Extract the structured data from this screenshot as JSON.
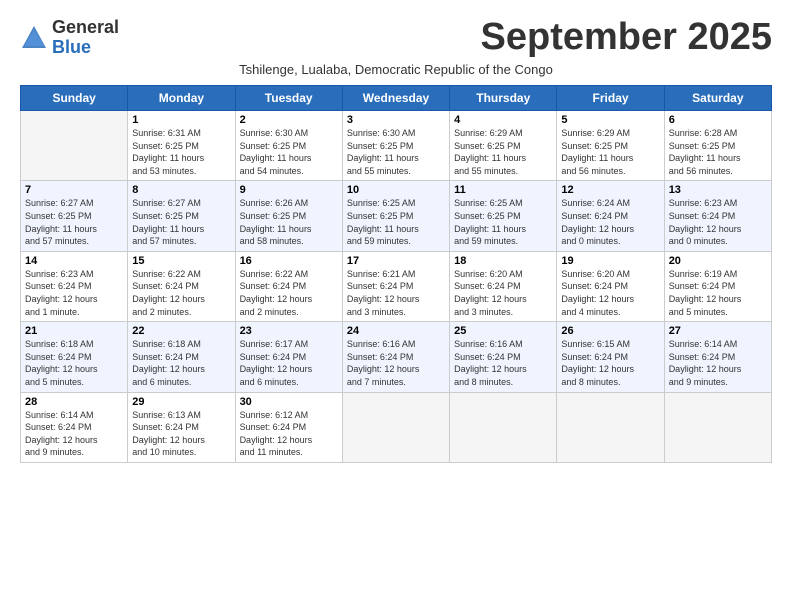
{
  "logo": {
    "general": "General",
    "blue": "Blue"
  },
  "title": "September 2025",
  "subtitle": "Tshilenge, Lualaba, Democratic Republic of the Congo",
  "days_of_week": [
    "Sunday",
    "Monday",
    "Tuesday",
    "Wednesday",
    "Thursday",
    "Friday",
    "Saturday"
  ],
  "weeks": [
    [
      {
        "day": "",
        "info": ""
      },
      {
        "day": "1",
        "info": "Sunrise: 6:31 AM\nSunset: 6:25 PM\nDaylight: 11 hours\nand 53 minutes."
      },
      {
        "day": "2",
        "info": "Sunrise: 6:30 AM\nSunset: 6:25 PM\nDaylight: 11 hours\nand 54 minutes."
      },
      {
        "day": "3",
        "info": "Sunrise: 6:30 AM\nSunset: 6:25 PM\nDaylight: 11 hours\nand 55 minutes."
      },
      {
        "day": "4",
        "info": "Sunrise: 6:29 AM\nSunset: 6:25 PM\nDaylight: 11 hours\nand 55 minutes."
      },
      {
        "day": "5",
        "info": "Sunrise: 6:29 AM\nSunset: 6:25 PM\nDaylight: 11 hours\nand 56 minutes."
      },
      {
        "day": "6",
        "info": "Sunrise: 6:28 AM\nSunset: 6:25 PM\nDaylight: 11 hours\nand 56 minutes."
      }
    ],
    [
      {
        "day": "7",
        "info": "Sunrise: 6:27 AM\nSunset: 6:25 PM\nDaylight: 11 hours\nand 57 minutes."
      },
      {
        "day": "8",
        "info": "Sunrise: 6:27 AM\nSunset: 6:25 PM\nDaylight: 11 hours\nand 57 minutes."
      },
      {
        "day": "9",
        "info": "Sunrise: 6:26 AM\nSunset: 6:25 PM\nDaylight: 11 hours\nand 58 minutes."
      },
      {
        "day": "10",
        "info": "Sunrise: 6:25 AM\nSunset: 6:25 PM\nDaylight: 11 hours\nand 59 minutes."
      },
      {
        "day": "11",
        "info": "Sunrise: 6:25 AM\nSunset: 6:25 PM\nDaylight: 11 hours\nand 59 minutes."
      },
      {
        "day": "12",
        "info": "Sunrise: 6:24 AM\nSunset: 6:24 PM\nDaylight: 12 hours\nand 0 minutes."
      },
      {
        "day": "13",
        "info": "Sunrise: 6:23 AM\nSunset: 6:24 PM\nDaylight: 12 hours\nand 0 minutes."
      }
    ],
    [
      {
        "day": "14",
        "info": "Sunrise: 6:23 AM\nSunset: 6:24 PM\nDaylight: 12 hours\nand 1 minute."
      },
      {
        "day": "15",
        "info": "Sunrise: 6:22 AM\nSunset: 6:24 PM\nDaylight: 12 hours\nand 2 minutes."
      },
      {
        "day": "16",
        "info": "Sunrise: 6:22 AM\nSunset: 6:24 PM\nDaylight: 12 hours\nand 2 minutes."
      },
      {
        "day": "17",
        "info": "Sunrise: 6:21 AM\nSunset: 6:24 PM\nDaylight: 12 hours\nand 3 minutes."
      },
      {
        "day": "18",
        "info": "Sunrise: 6:20 AM\nSunset: 6:24 PM\nDaylight: 12 hours\nand 3 minutes."
      },
      {
        "day": "19",
        "info": "Sunrise: 6:20 AM\nSunset: 6:24 PM\nDaylight: 12 hours\nand 4 minutes."
      },
      {
        "day": "20",
        "info": "Sunrise: 6:19 AM\nSunset: 6:24 PM\nDaylight: 12 hours\nand 5 minutes."
      }
    ],
    [
      {
        "day": "21",
        "info": "Sunrise: 6:18 AM\nSunset: 6:24 PM\nDaylight: 12 hours\nand 5 minutes."
      },
      {
        "day": "22",
        "info": "Sunrise: 6:18 AM\nSunset: 6:24 PM\nDaylight: 12 hours\nand 6 minutes."
      },
      {
        "day": "23",
        "info": "Sunrise: 6:17 AM\nSunset: 6:24 PM\nDaylight: 12 hours\nand 6 minutes."
      },
      {
        "day": "24",
        "info": "Sunrise: 6:16 AM\nSunset: 6:24 PM\nDaylight: 12 hours\nand 7 minutes."
      },
      {
        "day": "25",
        "info": "Sunrise: 6:16 AM\nSunset: 6:24 PM\nDaylight: 12 hours\nand 8 minutes."
      },
      {
        "day": "26",
        "info": "Sunrise: 6:15 AM\nSunset: 6:24 PM\nDaylight: 12 hours\nand 8 minutes."
      },
      {
        "day": "27",
        "info": "Sunrise: 6:14 AM\nSunset: 6:24 PM\nDaylight: 12 hours\nand 9 minutes."
      }
    ],
    [
      {
        "day": "28",
        "info": "Sunrise: 6:14 AM\nSunset: 6:24 PM\nDaylight: 12 hours\nand 9 minutes."
      },
      {
        "day": "29",
        "info": "Sunrise: 6:13 AM\nSunset: 6:24 PM\nDaylight: 12 hours\nand 10 minutes."
      },
      {
        "day": "30",
        "info": "Sunrise: 6:12 AM\nSunset: 6:24 PM\nDaylight: 12 hours\nand 11 minutes."
      },
      {
        "day": "",
        "info": ""
      },
      {
        "day": "",
        "info": ""
      },
      {
        "day": "",
        "info": ""
      },
      {
        "day": "",
        "info": ""
      }
    ]
  ]
}
